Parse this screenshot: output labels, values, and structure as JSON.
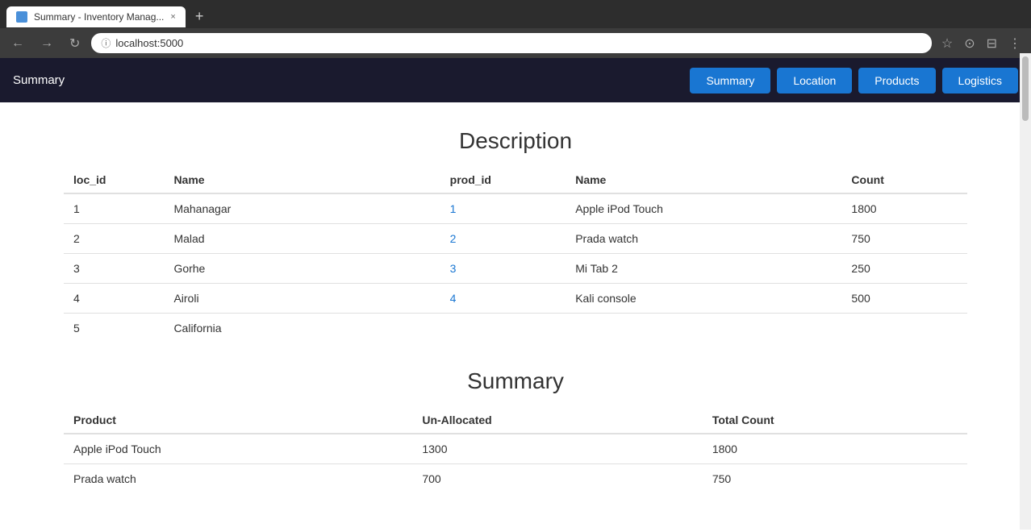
{
  "browser": {
    "tab_title": "Summary - Inventory Manag...",
    "tab_close": "×",
    "new_tab": "+",
    "url": "localhost:5000",
    "nav": {
      "back": "←",
      "forward": "→",
      "reload": "↻"
    }
  },
  "app": {
    "brand": "Summary",
    "nav_buttons": [
      {
        "label": "Summary",
        "key": "summary",
        "active": true
      },
      {
        "label": "Location",
        "key": "location",
        "active": false
      },
      {
        "label": "Products",
        "key": "products",
        "active": false
      },
      {
        "label": "Logistics",
        "key": "logistics",
        "active": false
      }
    ]
  },
  "description": {
    "title": "Description",
    "columns_left": [
      "loc_id",
      "Name"
    ],
    "columns_right": [
      "prod_id",
      "Name",
      "Count"
    ],
    "rows": [
      {
        "loc_id": "1",
        "loc_name": "Mahanagar",
        "prod_id": "1",
        "prod_name": "Apple iPod Touch",
        "count": "1800",
        "is_link_loc": false,
        "is_link_prod": true
      },
      {
        "loc_id": "2",
        "loc_name": "Malad",
        "prod_id": "2",
        "prod_name": "Prada watch",
        "count": "750",
        "is_link_loc": false,
        "is_link_prod": true
      },
      {
        "loc_id": "3",
        "loc_name": "Gorhe",
        "prod_id": "3",
        "prod_name": "Mi Tab 2",
        "count": "250",
        "is_link_loc": false,
        "is_link_prod": true
      },
      {
        "loc_id": "4",
        "loc_name": "Airoli",
        "prod_id": "4",
        "prod_name": "Kali console",
        "count": "500",
        "is_link_loc": false,
        "is_link_prod": true
      },
      {
        "loc_id": "5",
        "loc_name": "California",
        "prod_id": "",
        "prod_name": "",
        "count": "",
        "is_link_loc": false,
        "is_link_prod": false
      }
    ]
  },
  "summary": {
    "title": "Summary",
    "columns": [
      "Product",
      "Un-Allocated",
      "Total Count"
    ],
    "rows": [
      {
        "product": "Apple iPod Touch",
        "unallocated": "1300",
        "total": "1800"
      },
      {
        "product": "Prada watch",
        "unallocated": "700",
        "total": "750"
      }
    ]
  }
}
